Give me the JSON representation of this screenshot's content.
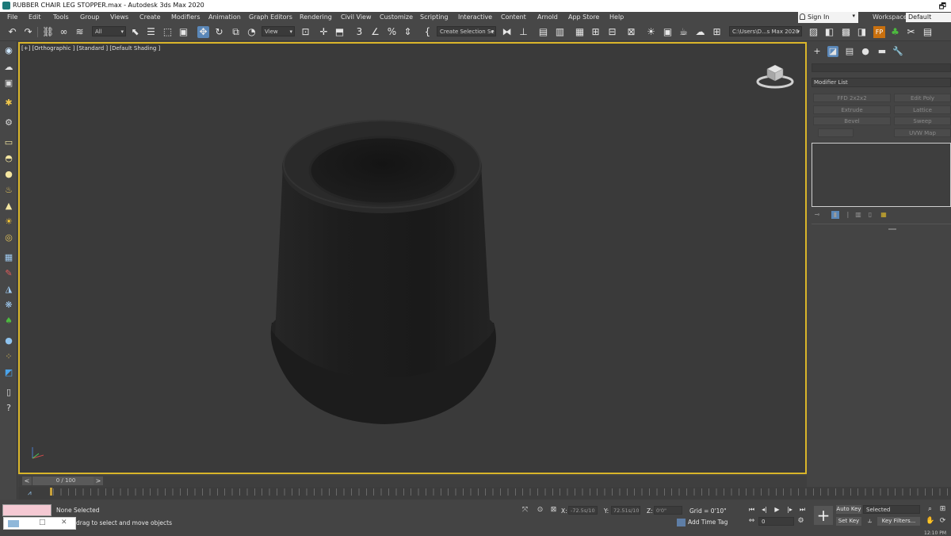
{
  "window": {
    "title": "RUBBER CHAIR LEG STOPPER.max - Autodesk 3ds Max 2020"
  },
  "menu": {
    "items": [
      "File",
      "Edit",
      "Tools",
      "Group",
      "Views",
      "Create",
      "Modifiers",
      "Animation",
      "Graph Editors",
      "Rendering",
      "Civil View",
      "Customize",
      "Scripting",
      "Interactive",
      "Content",
      "Arnold",
      "App Store",
      "Help"
    ],
    "sign_in": "Sign In",
    "workspaces_label": "Workspaces:",
    "workspaces_value": "Default"
  },
  "toolbar": {
    "selection_filter": "All",
    "reference_coord": "View",
    "named_selection": "Create Selection Se",
    "project_path": "C:\\Users\\D...s Max 2020"
  },
  "viewport": {
    "label": "[+] [Orthographic ] [Standard ] [Default Shading ]",
    "object_color": "#1b1b1b",
    "border_color": "#d9b52a"
  },
  "command_panel": {
    "modifier_list": "Modifier List",
    "modifier_buttons": [
      "FFD 2x2x2",
      "Edit Poly",
      "Extrude",
      "Lattice",
      "Bevel",
      "Sweep",
      "",
      "UVW Map"
    ]
  },
  "time_slider": {
    "position": "0 / 100",
    "prev": "<",
    "next": ">"
  },
  "status": {
    "selection": "None Selected",
    "prompt": "drag to select and move objects",
    "x_label": "X:",
    "x_value": "-72.5s/10",
    "y_label": "Y:",
    "y_value": "72.51s/10",
    "z_label": "Z:",
    "z_value": "0'0\"",
    "grid": "Grid = 0'10\"",
    "add_time_tag": "Add Time Tag",
    "frame": "0",
    "auto_key": "Auto Key",
    "set_key": "Set Key",
    "selected": "Selected",
    "key_filters": "Key Filters...",
    "clock": "12:10 PM"
  }
}
